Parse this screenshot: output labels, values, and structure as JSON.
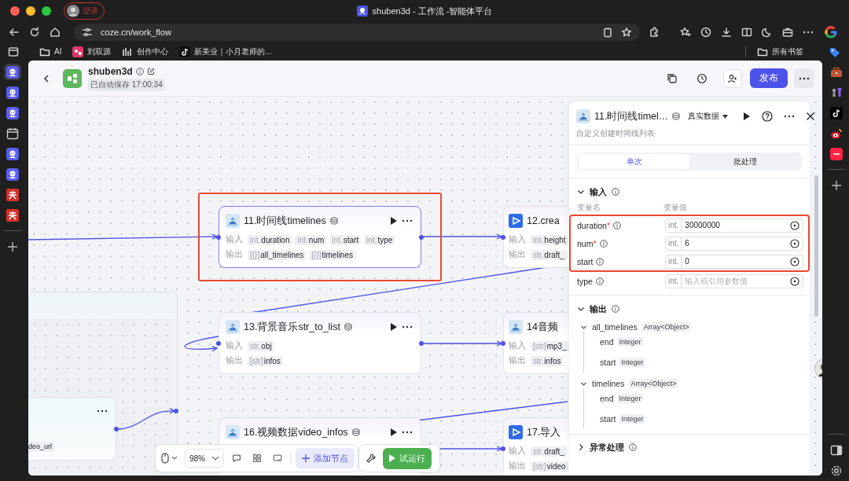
{
  "browser": {
    "profile": "登录",
    "title": "shuben3d - 工作流 -智能体平台",
    "url": "coze.cn/work_flow",
    "bookmarks": [
      {
        "label": "AI",
        "kind": "folder"
      },
      {
        "label": "刘双源",
        "kind": "app"
      },
      {
        "label": "创作中心",
        "kind": "chart"
      },
      {
        "label": "新美业｜小月老师的...",
        "kind": "note"
      }
    ],
    "all_bookmarks": "所有书签"
  },
  "left_rail": [
    {
      "kind": "coze",
      "selected": true
    },
    {
      "kind": "coze",
      "selected": false
    },
    {
      "kind": "coze",
      "selected": false
    },
    {
      "kind": "calendar",
      "selected": false
    },
    {
      "kind": "coze",
      "selected": false
    },
    {
      "kind": "coze",
      "selected": false
    },
    {
      "kind": "toutiao",
      "selected": false
    },
    {
      "kind": "toutiao",
      "selected": false
    }
  ],
  "right_rail": [
    {
      "kind": "briefcase"
    },
    {
      "kind": "chess"
    },
    {
      "kind": "tiktok"
    },
    {
      "kind": "weibo"
    },
    {
      "kind": "redbook"
    }
  ],
  "app": {
    "name": "shuben3d",
    "saved": "已自动保存 17:00:34",
    "publish": "发布"
  },
  "canvas": {
    "nodes": [
      {
        "kind": "plugin",
        "title": "11.时间线timelines",
        "selected": true,
        "highlighted": true,
        "cut": false,
        "input_label": "输入",
        "output_label": "输出",
        "inputs": [
          {
            "type": "int.",
            "name": "duration"
          },
          {
            "type": "int.",
            "name": "num"
          },
          {
            "type": "int.",
            "name": "start"
          },
          {
            "type": "int.",
            "name": "type"
          }
        ],
        "outputs": [
          {
            "type": "[{}]",
            "name": "all_timelines"
          },
          {
            "type": "[{}]",
            "name": "timelines"
          }
        ]
      },
      {
        "kind": "video",
        "title": "12.crea",
        "selected": false,
        "highlighted": false,
        "cut": true,
        "input_label": "输入",
        "output_label": "输出",
        "inputs": [
          {
            "type": "int.",
            "name": "height"
          }
        ],
        "outputs": [
          {
            "type": "str.",
            "name": "draft_"
          }
        ]
      },
      {
        "kind": "plugin",
        "title": "13.背景音乐str_to_list",
        "selected": false,
        "highlighted": false,
        "cut": false,
        "input_label": "输入",
        "output_label": "输出",
        "inputs": [
          {
            "type": "str.",
            "name": "obj"
          }
        ],
        "outputs": [
          {
            "type": "[str]",
            "name": "infos"
          }
        ]
      },
      {
        "kind": "plugin",
        "title": "14音频",
        "selected": false,
        "highlighted": false,
        "cut": true,
        "input_label": "输入",
        "output_label": "输出",
        "inputs": [
          {
            "type": "[str]",
            "name": "mp3_"
          }
        ],
        "outputs": [
          {
            "type": "str.",
            "name": "infos"
          }
        ]
      },
      {
        "kind": "plugin",
        "title": "16.视频数据video_infos",
        "selected": false,
        "highlighted": false,
        "cut": false
      },
      {
        "kind": "video",
        "title": "17.导入",
        "selected": false,
        "highlighted": false,
        "cut": true,
        "input_label": "输入",
        "output_label": "输出",
        "inputs": [
          {
            "type": "str.",
            "name": "draft_"
          }
        ],
        "outputs": [
          {
            "type": "[str]",
            "name": "video"
          }
        ]
      }
    ],
    "group_node": {
      "tag": "deo_url"
    }
  },
  "toolbar": {
    "zoom": "98%",
    "add_node": "添加节点",
    "run": "试运行"
  },
  "panel": {
    "title": "11.时间线timel…",
    "data_mode": "真实数据",
    "description": "自定义创建时间线列表",
    "tabs": [
      {
        "label": "单次",
        "selected": true
      },
      {
        "label": "批处理",
        "selected": false
      }
    ],
    "input_section": {
      "title": "输入",
      "expanded": true,
      "col_name": "变量名",
      "col_value": "变量值",
      "rows": [
        {
          "name": "duration",
          "required_mark": "*",
          "type": "int.",
          "value": "30000000",
          "highlighted": true
        },
        {
          "name": "num",
          "required_mark": "*",
          "type": "int.",
          "value": "6",
          "highlighted": true
        },
        {
          "name": "start",
          "type": "int.",
          "value": "0",
          "highlighted": true
        },
        {
          "name": "type",
          "type": "int.",
          "placeholder": "输入或引用参数值",
          "highlighted": false
        }
      ]
    },
    "output_section": {
      "title": "输出",
      "expanded": true,
      "tree": [
        {
          "name": "all_timelines",
          "type": "Array<Object>",
          "expanded": true,
          "children": [
            {
              "name": "end",
              "type": "Integer"
            },
            {
              "name": "start",
              "type": "Integer"
            }
          ]
        },
        {
          "name": "timelines",
          "type": "Array<Object>",
          "expanded": true,
          "children": [
            {
              "name": "end",
              "type": "Integer"
            },
            {
              "name": "start",
              "type": "Integer"
            }
          ]
        }
      ]
    },
    "error_section": {
      "title": "异常处理",
      "expanded": false
    }
  }
}
